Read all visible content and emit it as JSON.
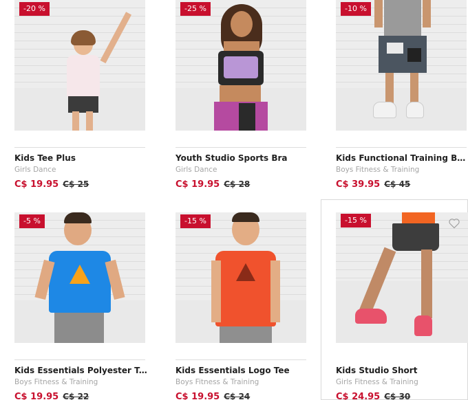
{
  "products": [
    {
      "badge": "-20 %",
      "name": "Kids Tee Plus",
      "category": "Girls Dance",
      "price": "C$ 19.95",
      "old_price": "C$ 25",
      "shirt_color": "#f6e7ea",
      "bottom_color": "#3b3b3b"
    },
    {
      "badge": "-25 %",
      "name": "Youth Studio Sports Bra",
      "category": "Girls Dance",
      "price": "C$ 19.95",
      "old_price": "C$ 28",
      "shirt_color": "#2a2a2a",
      "bottom_color": "#b54aa0"
    },
    {
      "badge": "-10 %",
      "name": "Kids Functional Training Board...",
      "category": "Boys Fitness & Training",
      "price": "C$ 39.95",
      "old_price": "C$ 45",
      "shirt_color": "#9a9a9a",
      "bottom_color": "#4b5560"
    },
    {
      "badge": "-5 %",
      "name": "Kids Essentials Polyester Tee",
      "category": "Boys Fitness & Training",
      "price": "C$ 19.95",
      "old_price": "C$ 22",
      "shirt_color": "#1e88e5",
      "bottom_color": "#8c8c8c"
    },
    {
      "badge": "-15 %",
      "name": "Kids Essentials Logo Tee",
      "category": "Boys Fitness & Training",
      "price": "C$ 19.95",
      "old_price": "C$ 24",
      "shirt_color": "#f0522d",
      "bottom_color": "#8f8f8f"
    },
    {
      "badge": "-15 %",
      "name": "Kids Studio Short",
      "category": "Girls Fitness & Training",
      "price": "C$ 24.95",
      "old_price": "C$ 30",
      "shirt_color": "#f26522",
      "bottom_color": "#3d3d3d"
    }
  ],
  "colors": {
    "sale_red": "#c8102e",
    "text_dark": "#1f1f1f",
    "text_muted": "#a5a5a5"
  },
  "icons": {
    "wishlist": "heart-outline-icon"
  }
}
